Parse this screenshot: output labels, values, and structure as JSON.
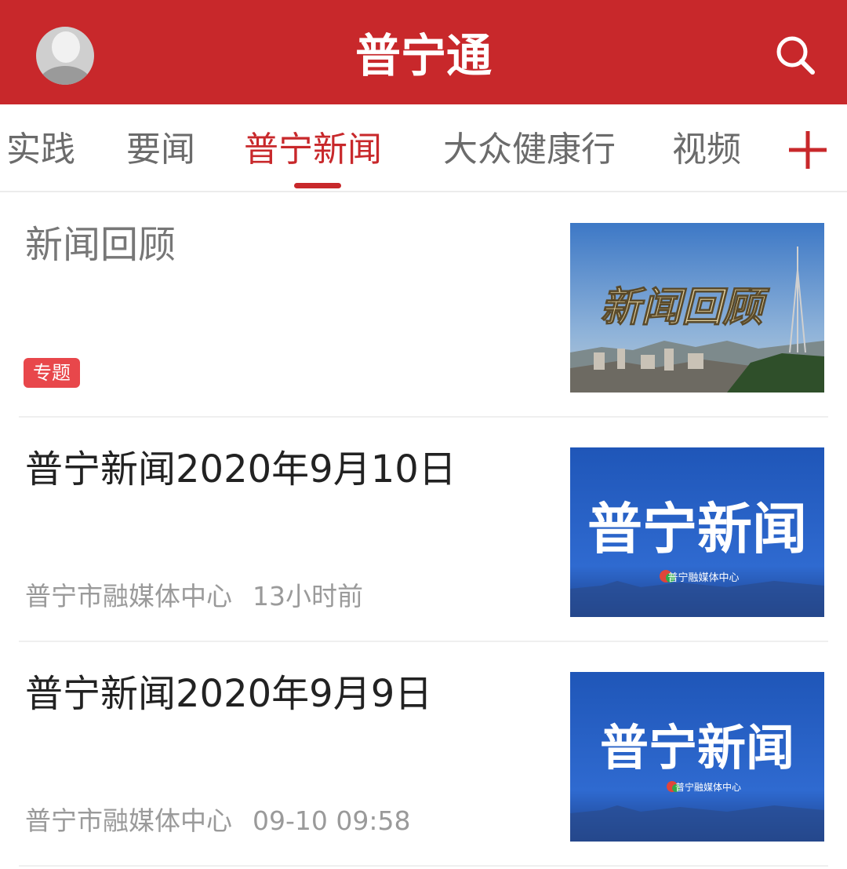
{
  "header": {
    "title": "普宁通",
    "avatar_icon": "user-avatar-icon",
    "search_icon": "search-icon",
    "color": "#c8282b"
  },
  "tabs": {
    "items": [
      {
        "label": "实践",
        "active": false
      },
      {
        "label": "要闻",
        "active": false
      },
      {
        "label": "普宁新闻",
        "active": true
      },
      {
        "label": "大众健康行",
        "active": false
      },
      {
        "label": "视频",
        "active": false
      }
    ],
    "add_icon": "plus-icon",
    "active_color": "#c8282b"
  },
  "news": [
    {
      "title": "新闻回顾",
      "tag": "专题",
      "thumb_text": "新闻回顾"
    },
    {
      "title": "普宁新闻2020年9月10日",
      "source": "普宁市融媒体中心",
      "time": "13小时前",
      "thumb_text": "普宁新闻",
      "thumb_sub": "普宁融媒体中心"
    },
    {
      "title": "普宁新闻2020年9月9日",
      "source": "普宁市融媒体中心",
      "time": "09-10 09:58",
      "thumb_text": "普宁新闻",
      "thumb_sub": "普宁融媒体中心"
    }
  ]
}
